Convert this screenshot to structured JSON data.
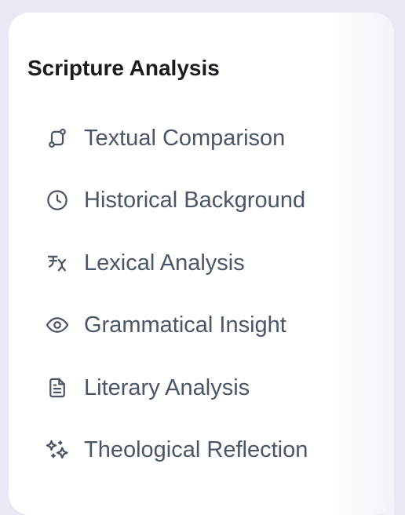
{
  "panel": {
    "title": "Scripture Analysis",
    "items": [
      {
        "label": "Textual Comparison",
        "icon": "git-compare-icon"
      },
      {
        "label": "Historical Background",
        "icon": "clock-icon"
      },
      {
        "label": "Lexical Analysis",
        "icon": "translate-icon"
      },
      {
        "label": "Grammatical Insight",
        "icon": "eye-icon"
      },
      {
        "label": "Literary Analysis",
        "icon": "document-icon"
      },
      {
        "label": "Theological Reflection",
        "icon": "sparkles-icon"
      }
    ]
  },
  "colors": {
    "background": "#ebe8f3",
    "card": "#ffffff",
    "title": "#1b1b22",
    "label": "#4a5568",
    "icon": "#4a5465"
  }
}
